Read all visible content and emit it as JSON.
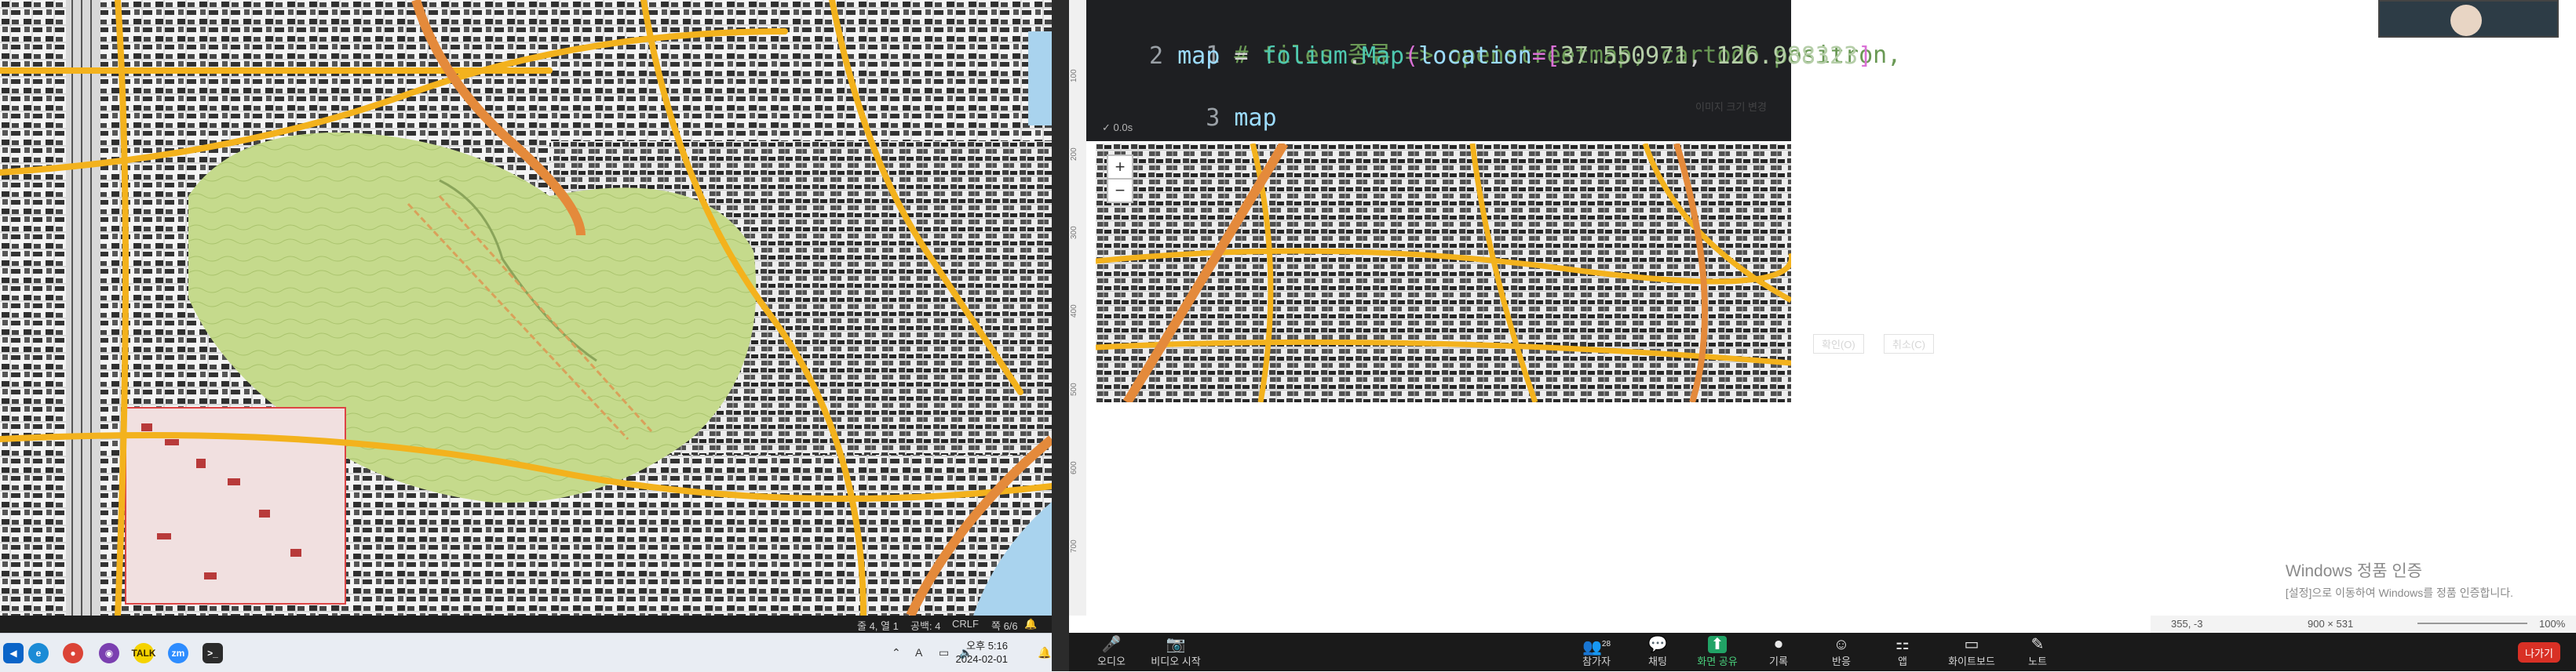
{
  "left_statusbar": {
    "position": "줄 4, 열 1",
    "spaces": "공백: 4",
    "eol": "CRLF",
    "page": "쪽 6/6"
  },
  "taskbar": {
    "icons": [
      "windows-logo-icon",
      "edge-icon",
      "chrome-icon",
      "app-icon",
      "kakaotalk-icon",
      "zoom-icon",
      "terminal-icon"
    ],
    "zoom_label": "zm",
    "clock_time": "오후 5:16",
    "clock_date": "2024-02-01",
    "tray_ime": "A"
  },
  "ruler": {
    "ticks": [
      "100",
      "200",
      "300",
      "400",
      "500",
      "600",
      "700"
    ]
  },
  "notebook": {
    "lines": [
      {
        "num": "1",
        "text": "# tiles 종류 => openstreetmap, cartodb positron,"
      },
      {
        "num": "2",
        "text_parts": [
          "map",
          " = ",
          "folium",
          ".",
          "Map",
          "(",
          "location",
          "=[",
          "37.550971",
          ", ",
          "126.988323",
          "]"
        ]
      },
      {
        "num": "3",
        "text": "map"
      }
    ],
    "exec_time": "0.0s",
    "zoom_in": "+",
    "zoom_out": "−"
  },
  "ghost_dialog": {
    "title": "이미지 크기 변경",
    "ok": "확인(O)",
    "cancel": "취소(C)"
  },
  "windows_watermark": {
    "title": "Windows 정품 인증",
    "subtitle": "[설정]으로 이동하여 Windows를 정품 인증합니다."
  },
  "share_statusbar": {
    "cursor": "355, -3",
    "size": "900 × 531",
    "zoom": "100%"
  },
  "zoom_toolbar": {
    "items": [
      {
        "name": "audio",
        "label": "오디오",
        "icon": "🎤"
      },
      {
        "name": "video",
        "label": "비디오 시작",
        "icon": "📷"
      },
      {
        "name": "participants",
        "label": "참가자",
        "icon": "👥",
        "count": "28"
      },
      {
        "name": "chat",
        "label": "채팅",
        "icon": "💬"
      },
      {
        "name": "share",
        "label": "화면 공유",
        "icon": "⬆"
      },
      {
        "name": "record",
        "label": "기록",
        "icon": "⏺"
      },
      {
        "name": "reactions",
        "label": "반응",
        "icon": "☺"
      },
      {
        "name": "apps",
        "label": "앱",
        "icon": "⚏"
      },
      {
        "name": "whiteboard",
        "label": "화이트보드",
        "icon": "▭"
      },
      {
        "name": "notes",
        "label": "노트",
        "icon": "✎"
      }
    ],
    "leave": "나가기"
  },
  "colors": {
    "park": "#c8dc95",
    "road_major": "#f3b21d",
    "road_motorway": "#e48a3b",
    "water": "#a9d3ee",
    "building": "#3a3a3a",
    "code_bg": "#1e1f22"
  }
}
